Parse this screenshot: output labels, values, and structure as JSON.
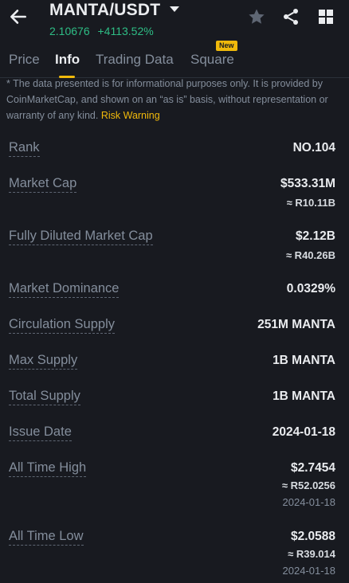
{
  "header": {
    "pair": "MANTA/USDT",
    "last_price": "2.10676",
    "change_pct": "+4113.52%",
    "icons": [
      "back-arrow-icon",
      "caret-down-icon",
      "star-icon",
      "share-icon",
      "grid-icon"
    ]
  },
  "tabs": [
    {
      "label": "Price",
      "active": false
    },
    {
      "label": "Info",
      "active": true
    },
    {
      "label": "Trading Data",
      "active": false
    },
    {
      "label": "Square",
      "active": false,
      "badge": "New"
    }
  ],
  "disclaimer": {
    "text": "* The data presented is for informational purposes only. It is provided by CoinMarketCap, and shown on an “as is” basis, without representation or warranty of any kind.",
    "link": "Risk Warning"
  },
  "stats": {
    "rank": {
      "label": "Rank",
      "value": "NO.104"
    },
    "market_cap": {
      "label": "Market Cap",
      "value": "$533.31M",
      "local": "≈ R10.11B"
    },
    "fdmc": {
      "label": "Fully Diluted Market Cap",
      "value": "$2.12B",
      "local": "≈ R40.26B"
    },
    "dominance": {
      "label": "Market Dominance",
      "value": "0.0329%"
    },
    "circulation": {
      "label": "Circulation Supply",
      "value": "251M MANTA"
    },
    "max_supply": {
      "label": "Max Supply",
      "value": "1B MANTA"
    },
    "total_supply": {
      "label": "Total Supply",
      "value": "1B MANTA"
    },
    "issue_date": {
      "label": "Issue Date",
      "value": "2024-01-18"
    },
    "ath": {
      "label": "All Time High",
      "value": "$2.7454",
      "local": "≈ R52.0256",
      "date": "2024-01-18"
    },
    "atl": {
      "label": "All Time Low",
      "value": "$2.0588",
      "local": "≈ R39.014",
      "date": "2024-01-18"
    }
  },
  "colors": {
    "background": "#181a20",
    "positive": "#2ebd85",
    "accent": "#f0b90b",
    "muted": "#848e9c",
    "text": "#eaecef"
  }
}
